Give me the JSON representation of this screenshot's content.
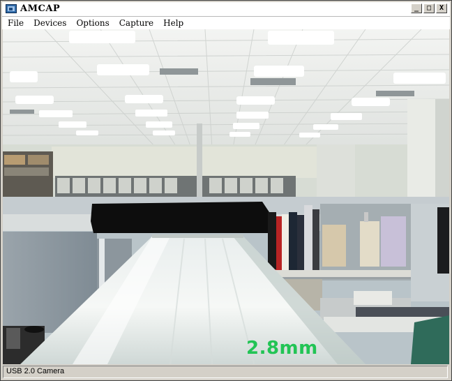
{
  "window": {
    "title": "AMCAP"
  },
  "title_buttons": {
    "minimize": "_",
    "maximize": "□",
    "close": "X"
  },
  "menu": [
    {
      "label": "File"
    },
    {
      "label": "Devices"
    },
    {
      "label": "Options"
    },
    {
      "label": "Capture"
    },
    {
      "label": "Help"
    }
  ],
  "video": {
    "overlay_text": "2.8mm"
  },
  "status": {
    "device": "USB 2.0 Camera"
  },
  "colors": {
    "overlay": "#22c455",
    "titlebar": "#ffffff",
    "chrome": "#d4d0c8"
  },
  "icons": {
    "app": "webcam-app-icon"
  }
}
